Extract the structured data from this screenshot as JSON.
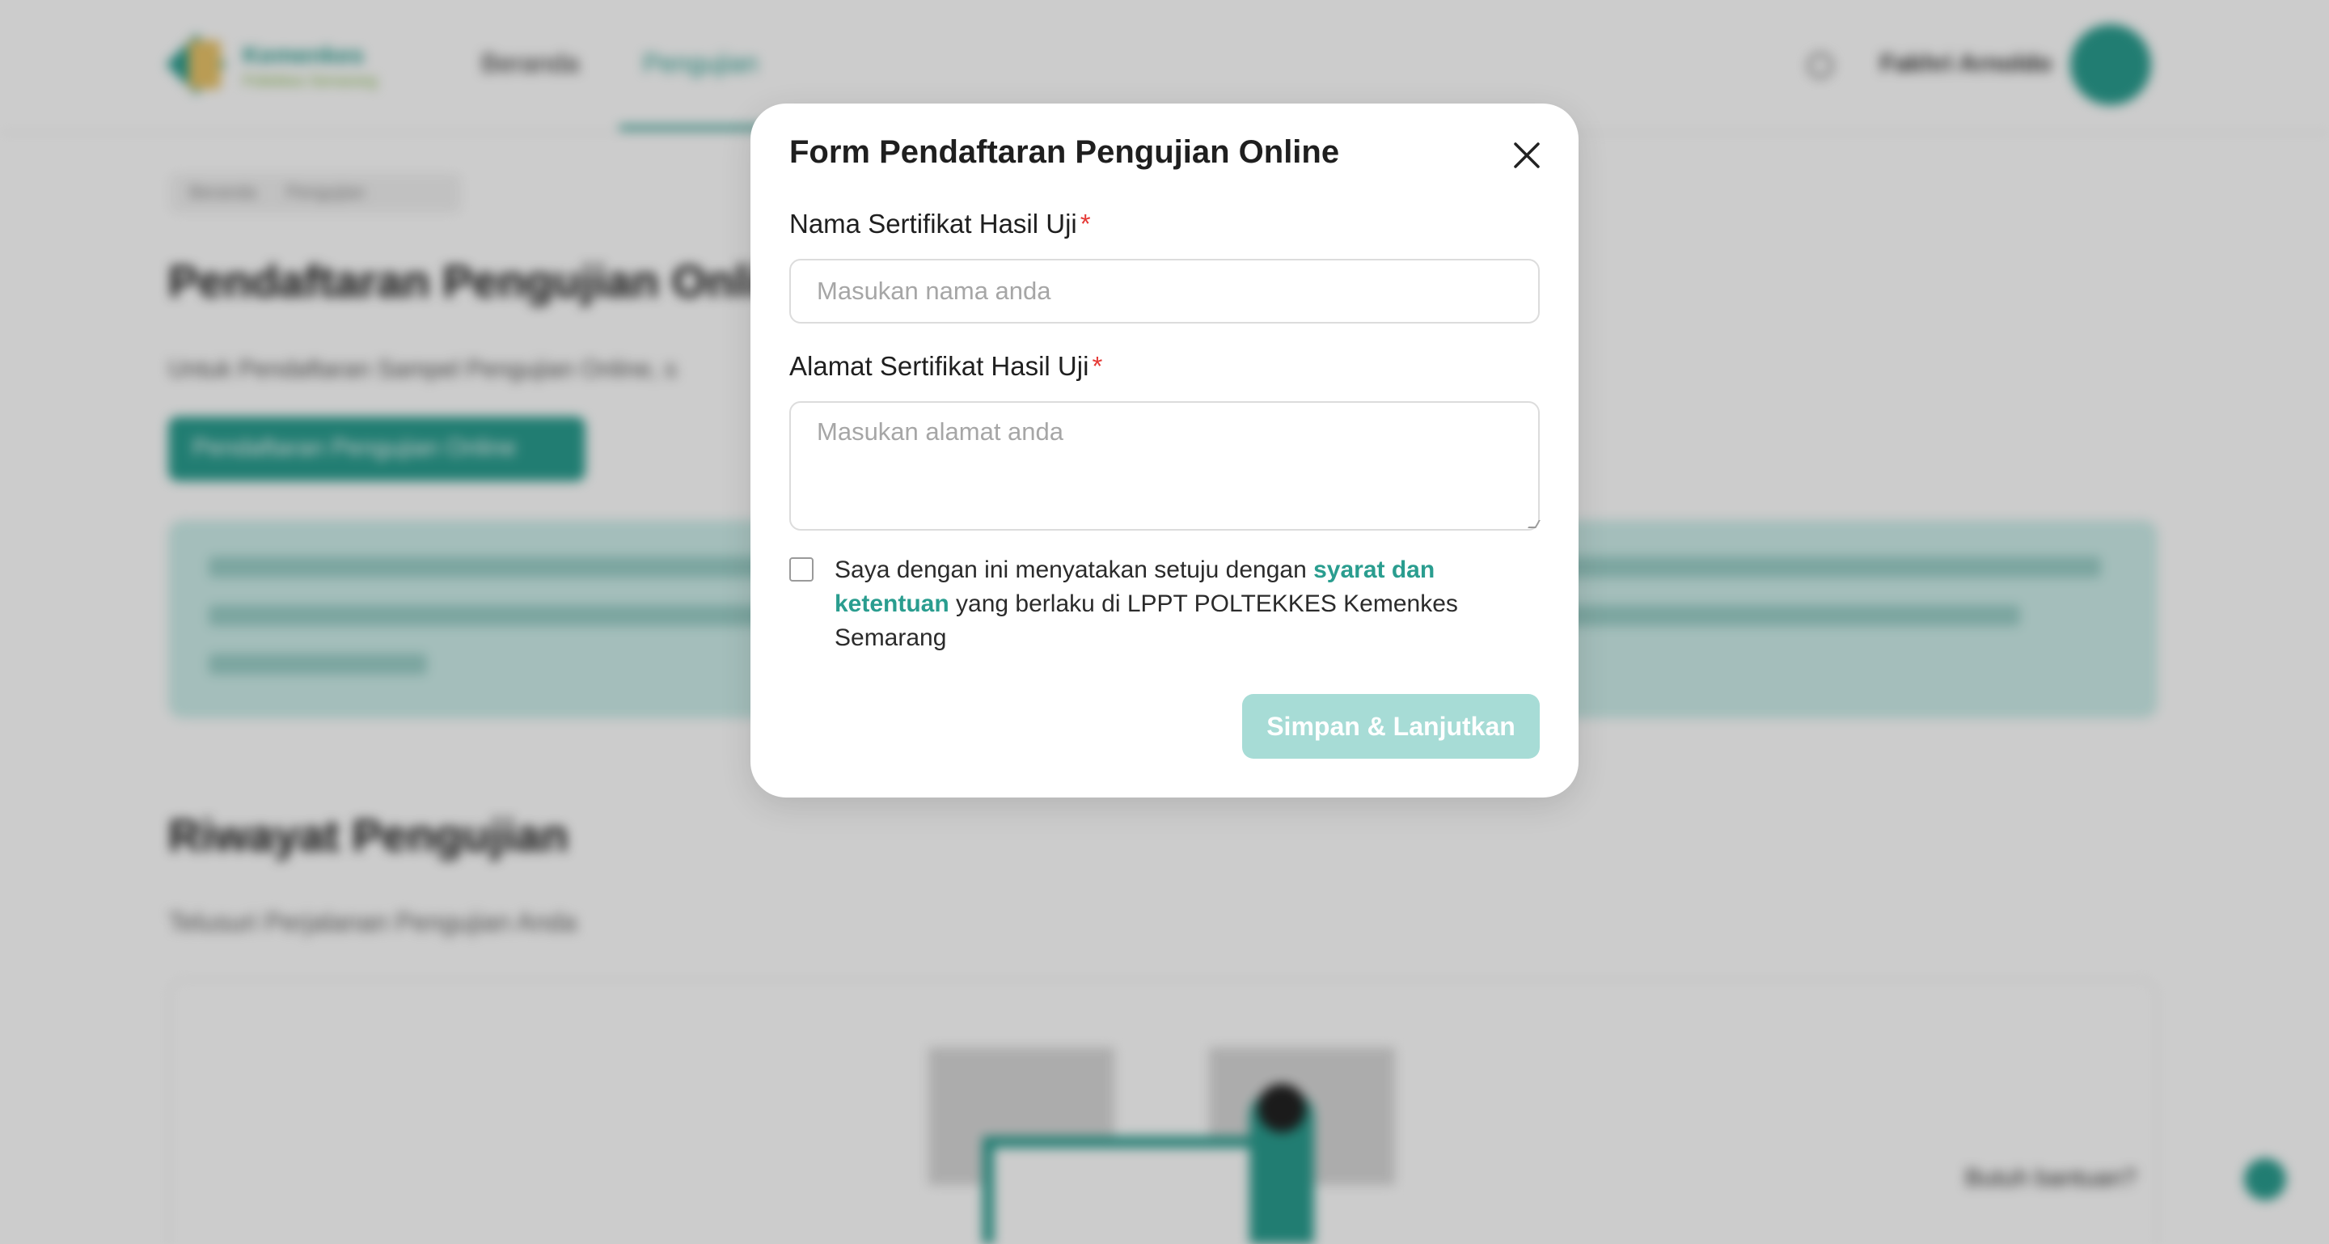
{
  "background": {
    "logo": {
      "line1": "Kemenkes",
      "line2": "Poltekkes Semarang"
    },
    "nav": {
      "beranda": "Beranda",
      "pengujian": "Pengujian"
    },
    "user": {
      "name": "Fakhri Arnoldo"
    },
    "breadcrumb": {
      "home": "Beranda",
      "current": "Pengujian"
    },
    "page_title": "Pendaftaran Pengujian Online",
    "page_description": "Untuk Pendaftaran Sampel Pengujian Online, s",
    "register_button": "Pendaftaran Pengujian Online",
    "history_title": "Riwayat Pengujian",
    "history_subtitle": "Telusuri Perjalanan Pengujian Anda",
    "help_text": "Butuh bantuan?"
  },
  "modal": {
    "title": "Form Pendaftaran Pengujian Online",
    "nama": {
      "label": "Nama Sertifikat Hasil Uji",
      "required_mark": "*",
      "placeholder": "Masukan nama anda",
      "value": ""
    },
    "alamat": {
      "label": "Alamat Sertifikat Hasil Uji",
      "required_mark": "*",
      "placeholder": "Masukan alamat anda",
      "value": ""
    },
    "agreement": {
      "checked": false,
      "text_before": "Saya dengan ini menyatakan setuju dengan ",
      "link": "syarat dan ketentuan",
      "text_after": " yang berlaku di LPPT POLTEKKES Kemenkes Semarang"
    },
    "submit_label": "Simpan & Lanjutkan"
  },
  "colors": {
    "accent": "#2a9d8f",
    "submit_disabled": "#a7dcd6",
    "required": "#e53935"
  },
  "icons": {
    "close": "close-icon"
  }
}
